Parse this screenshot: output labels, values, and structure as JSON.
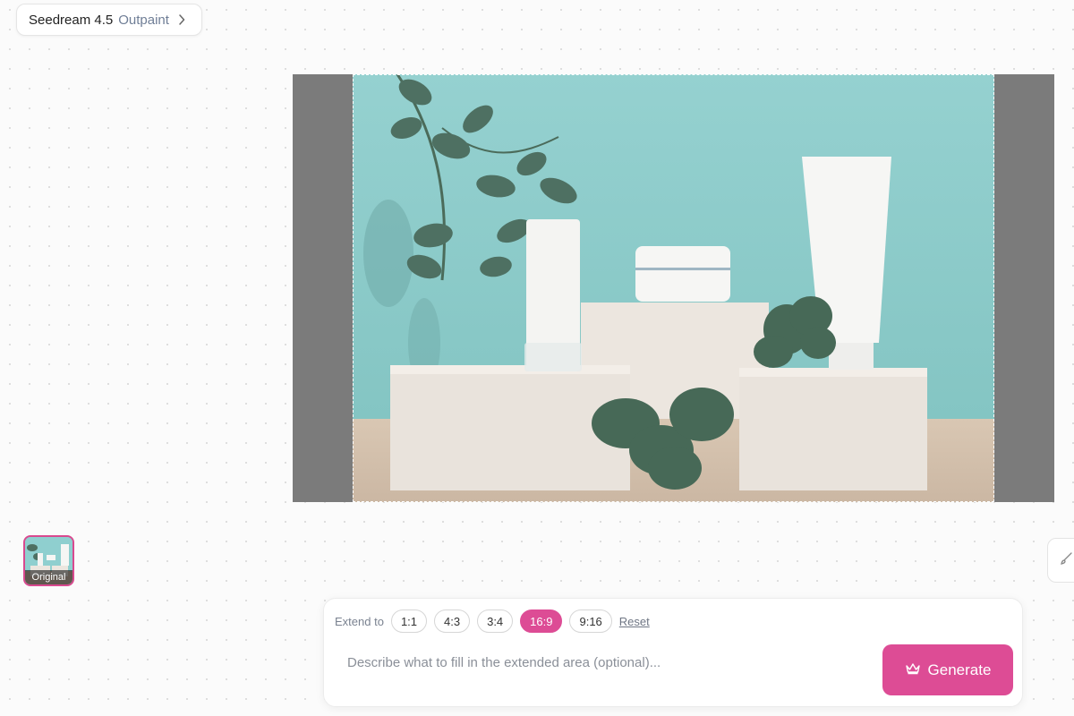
{
  "header": {
    "model_name": "Seedream 4.5",
    "mode_name": "Outpaint",
    "chevron_icon": "chevron-right-icon"
  },
  "canvas": {
    "image_alt": "Skincare product photo with eucalyptus leaves",
    "padding_color": "#7b7b7b",
    "background_color": "#8ccbc9"
  },
  "thumbnail": {
    "label": "Original",
    "border_color": "#d9498f"
  },
  "side_tool": {
    "icon": "brush-icon"
  },
  "panel": {
    "extend_label": "Extend to",
    "ratios": [
      {
        "label": "1:1",
        "active": false
      },
      {
        "label": "4:3",
        "active": false
      },
      {
        "label": "3:4",
        "active": false
      },
      {
        "label": "16:9",
        "active": true
      },
      {
        "label": "9:16",
        "active": false
      }
    ],
    "reset_label": "Reset",
    "prompt_placeholder": "Describe what to fill in the extended area (optional)...",
    "generate_label": "Generate",
    "generate_icon": "crown-icon",
    "accent_color": "#dd4c95"
  }
}
